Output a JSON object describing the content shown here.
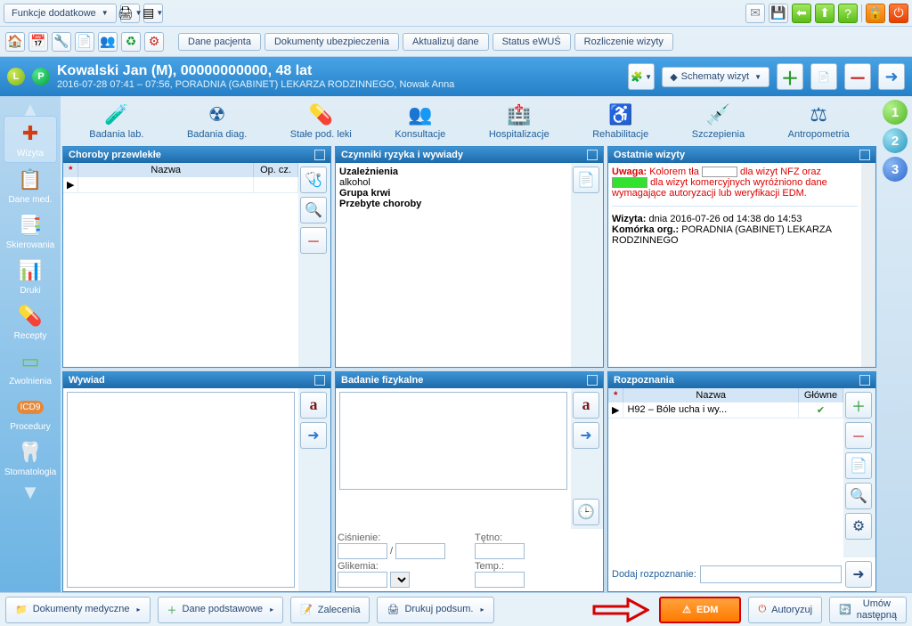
{
  "toolbar1": {
    "extra_functions": "Funkcje dodatkowe"
  },
  "toolbar2": {
    "dane_pacjenta": "Dane pacjenta",
    "dokumenty_ubezp": "Dokumenty ubezpieczenia",
    "aktualizuj_dane": "Aktualizuj dane",
    "status_ewus": "Status eWUŚ",
    "rozliczenie_wizyty": "Rozliczenie wizyty"
  },
  "patient": {
    "name_line": "Kowalski Jan (M), 00000000000, 48 lat",
    "sub_line": "2016-07-28 07:41 – 07:56, PORADNIA (GABINET) LEKARZA RODZINNEGO, Nowak Anna",
    "schemes_label": "Schematy wizyt"
  },
  "leftnav": {
    "wizyta": "Wizyta",
    "dane_med": "Dane med.",
    "skierowania": "Skierowania",
    "druki": "Druki",
    "recepty": "Recepty",
    "zwolnienia": "Zwolnienia",
    "procedury": "Procedury",
    "icd9": "ICD9",
    "stomatologia": "Stomatologia"
  },
  "categories": {
    "badania_lab": "Badania lab.",
    "badania_diag": "Badania diag.",
    "stale_leki": "Stałe pod. leki",
    "konsultacje": "Konsultacje",
    "hospitalizacje": "Hospitalizacje",
    "rehabilitacje": "Rehabilitacje",
    "szczepienia": "Szczepienia",
    "antropometria": "Antropometria"
  },
  "panels": {
    "choroby_hd": "Choroby przewlekłe",
    "choroby_col_nazwa": "Nazwa",
    "choroby_col_opcz": "Op. cz.",
    "czynniki_hd": "Czynniki ryzyka i wywiady",
    "czynniki_body": {
      "uzaleznienia": "Uzależnienia",
      "alkohol": "alkohol",
      "grupa_krwi": "Grupa krwi",
      "przebyte": "Przebyte choroby"
    },
    "ostatnie_hd": "Ostatnie wizyty",
    "ostatnie": {
      "uwaga_label": "Uwaga:",
      "uwaga_text1": "Kolorem tła ",
      "uwaga_text2": " dla wizyt NFZ oraz ",
      "uwaga_text3": " dla wizyt komercyjnych wyróżniono dane wymagające autoryzacji lub weryfikacji EDM.",
      "wizyta_label": "Wizyta:",
      "wizyta_val": "dnia 2016-07-26 od 14:38 do 14:53",
      "komorka_label": "Komórka org.:",
      "komorka_val": "PORADNIA (GABINET) LEKARZA RODZINNEGO"
    },
    "wywiad_hd": "Wywiad",
    "badanie_hd": "Badanie fizykalne",
    "badanie": {
      "cisnienie": "Ciśnienie:",
      "tetno": "Tętno:",
      "glikemia": "Glikemia:",
      "temp": "Temp.:"
    },
    "rozpoznania_hd": "Rozpoznania",
    "rozpoznania_col_nazwa": "Nazwa",
    "rozpoznania_col_glowne": "Główne",
    "rozpoznania_row1": "H92 – Bóle ucha i wy...",
    "dodaj_rozpoznanie": "Dodaj rozpoznanie:"
  },
  "bottom": {
    "dokumenty_med": "Dokumenty medyczne",
    "dane_podst": "Dane podstawowe",
    "zalecenia": "Zalecenia",
    "drukuj_podsum": "Drukuj podsum.",
    "edm": "EDM",
    "autoryzuj": "Autoryzuj",
    "umow_nastepna": "Umów\nnastępną"
  }
}
